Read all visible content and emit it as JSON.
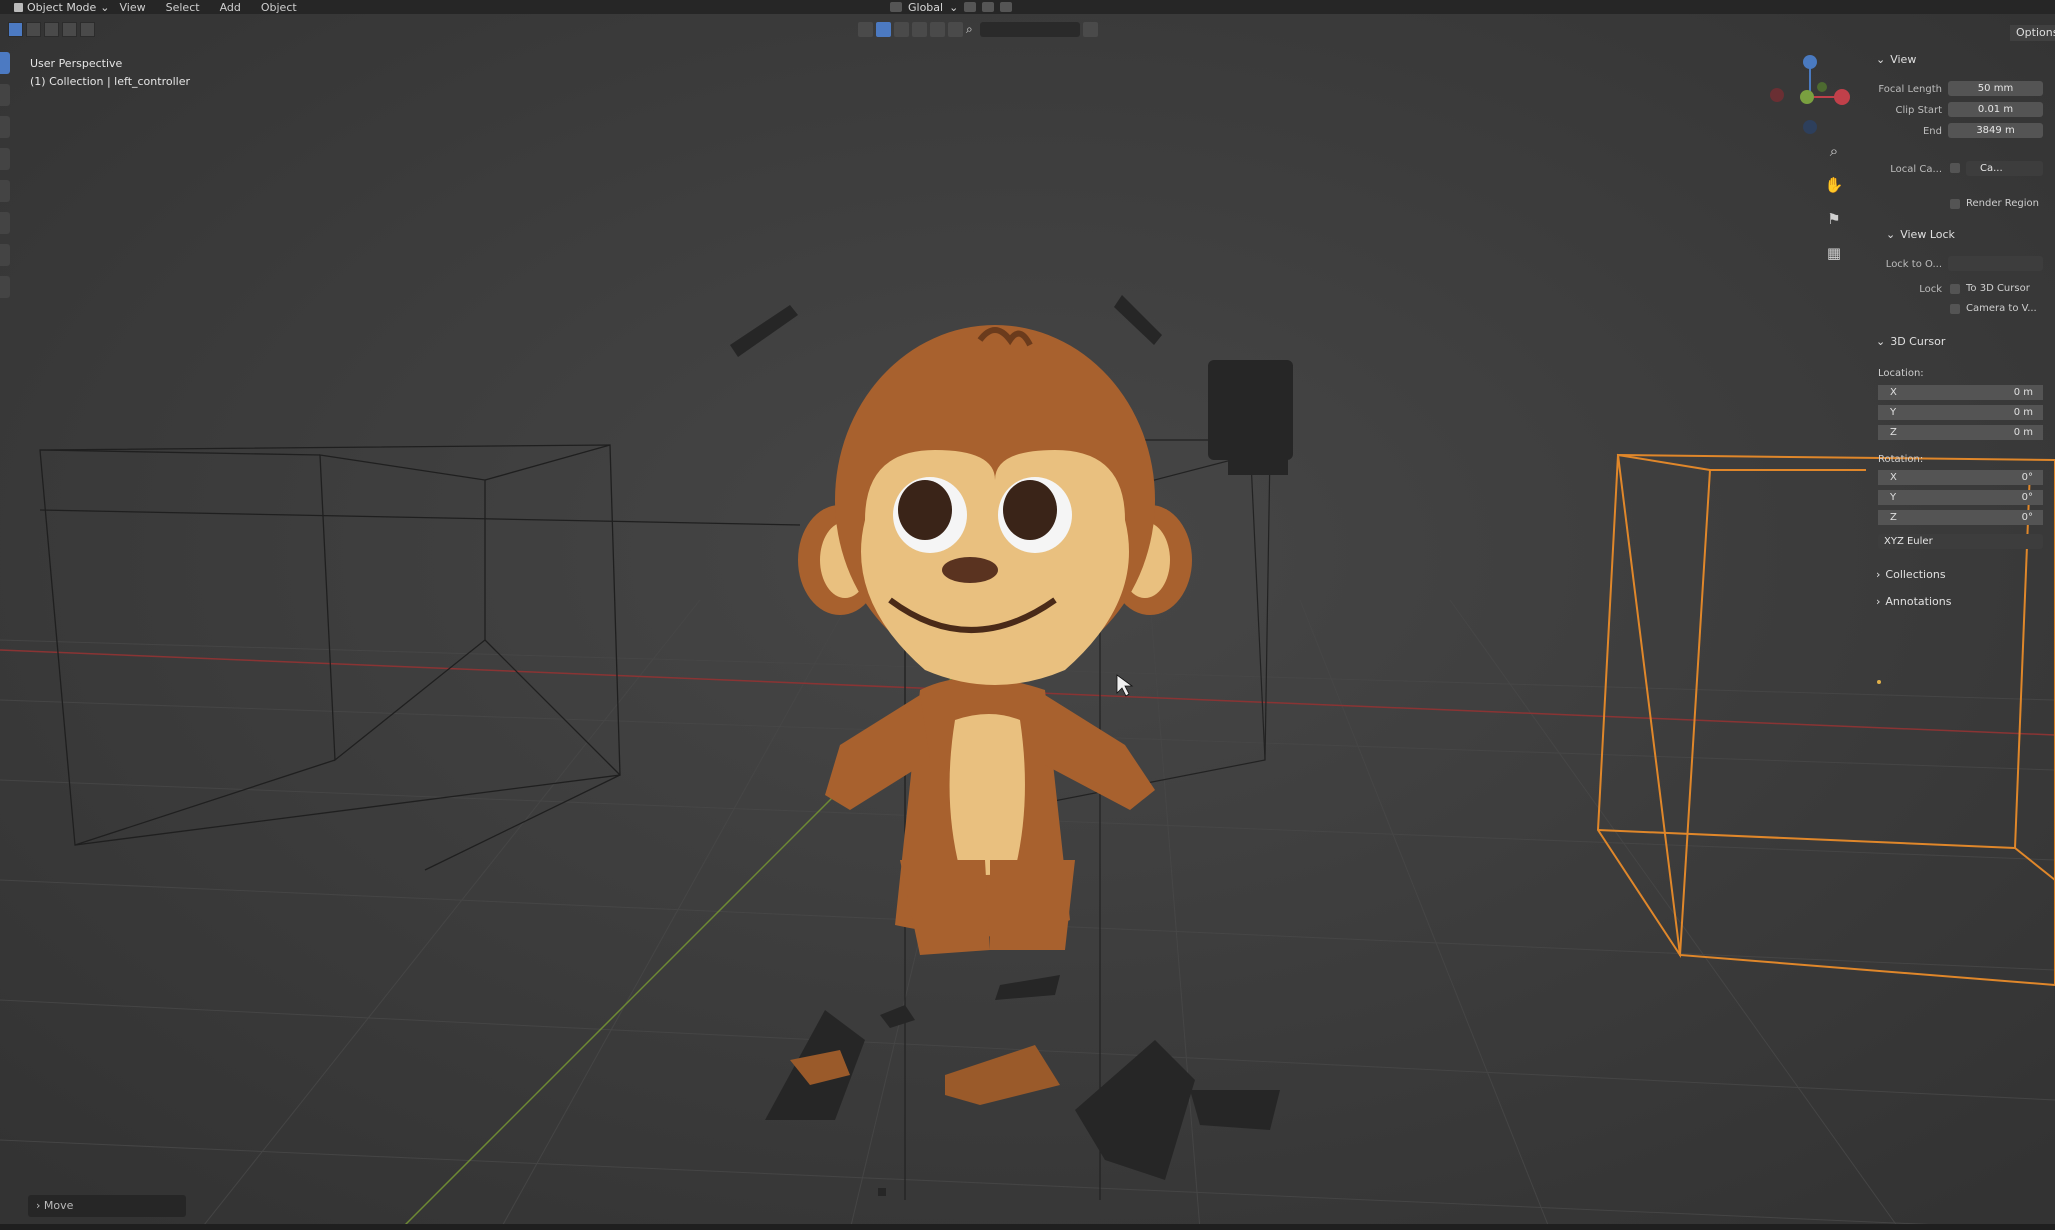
{
  "header": {
    "mode": "Object Mode",
    "menus": [
      "View",
      "Select",
      "Add",
      "Object"
    ],
    "orientation": "Global"
  },
  "viewport": {
    "perspective": "User Perspective",
    "context": "(1) Collection | left_controller"
  },
  "sidebar": {
    "options_label": "Options",
    "view": {
      "title": "View",
      "focal_length_label": "Focal Length",
      "focal_length": "50 mm",
      "clip_start_label": "Clip Start",
      "clip_start": "0.01 m",
      "end_label": "End",
      "end": "3849 m",
      "local_camera_label": "Local Ca...",
      "local_camera_value": "Ca...",
      "render_region_label": "Render Region"
    },
    "view_lock": {
      "title": "View Lock",
      "lock_to_label": "Lock to O...",
      "lock_label": "Lock",
      "to_cursor_label": "To 3D Cursor",
      "camera_to_view_label": "Camera to V..."
    },
    "cursor": {
      "title": "3D Cursor",
      "location_label": "Location:",
      "location": [
        {
          "axis": "X",
          "value": "0 m"
        },
        {
          "axis": "Y",
          "value": "0 m"
        },
        {
          "axis": "Z",
          "value": "0 m"
        }
      ],
      "rotation_label": "Rotation:",
      "rotation": [
        {
          "axis": "X",
          "value": "0°"
        },
        {
          "axis": "Y",
          "value": "0°"
        },
        {
          "axis": "Z",
          "value": "0°"
        }
      ],
      "rotation_mode": "XYZ Euler"
    },
    "collections_title": "Collections",
    "annotations_title": "Annotations"
  },
  "operator_panel": {
    "label": "Move"
  },
  "colors": {
    "selected_outline": "#e0872a",
    "active_tool": "#4c7ac2",
    "x_axis": "#a33a3a",
    "y_axis": "#7a9a3a"
  }
}
